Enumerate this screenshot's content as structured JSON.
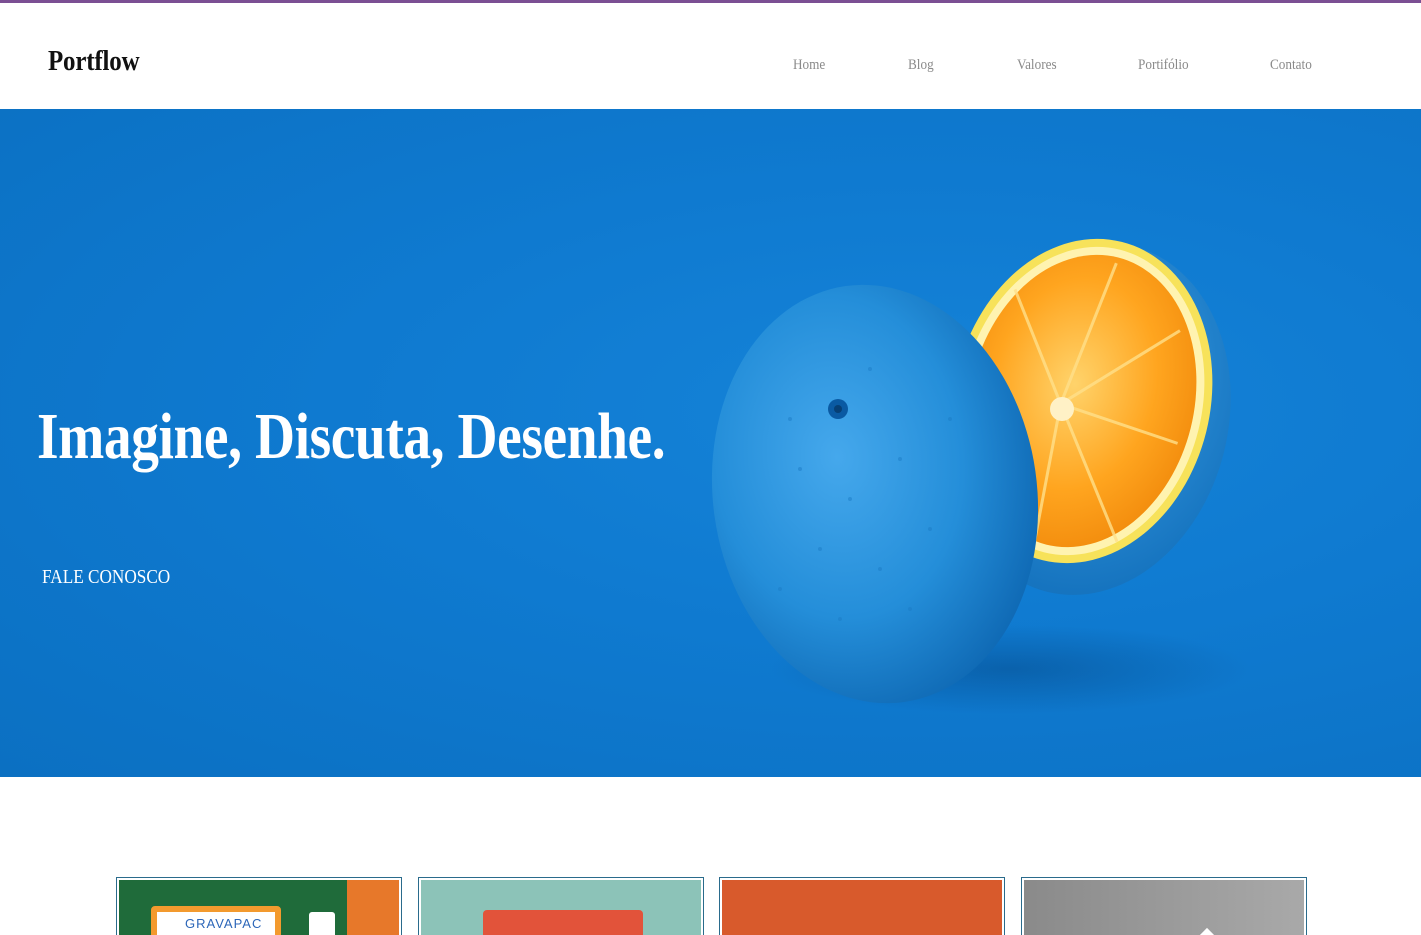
{
  "brand": {
    "name": "Portflow"
  },
  "nav": {
    "items": [
      {
        "label": "Home"
      },
      {
        "label": "Blog"
      },
      {
        "label": "Valores"
      },
      {
        "label": "Portifólio"
      },
      {
        "label": "Contato"
      }
    ]
  },
  "hero": {
    "title": "Imagine, Discuta, Desenhe.",
    "cta_label": "FALE CONOSCO",
    "background_color": "#0d77cc"
  },
  "portfolio": {
    "cards": [
      {
        "label": "GRAVAPAC",
        "color": "#1f6b3a"
      },
      {
        "label": "",
        "color": "#8cc3b8"
      },
      {
        "label": "",
        "color": "#d85a2c"
      },
      {
        "label": "",
        "color": "#8d8d8d"
      }
    ]
  },
  "colors": {
    "accent_stripe": "#7b4f93",
    "nav_text": "#8a8a8a"
  }
}
